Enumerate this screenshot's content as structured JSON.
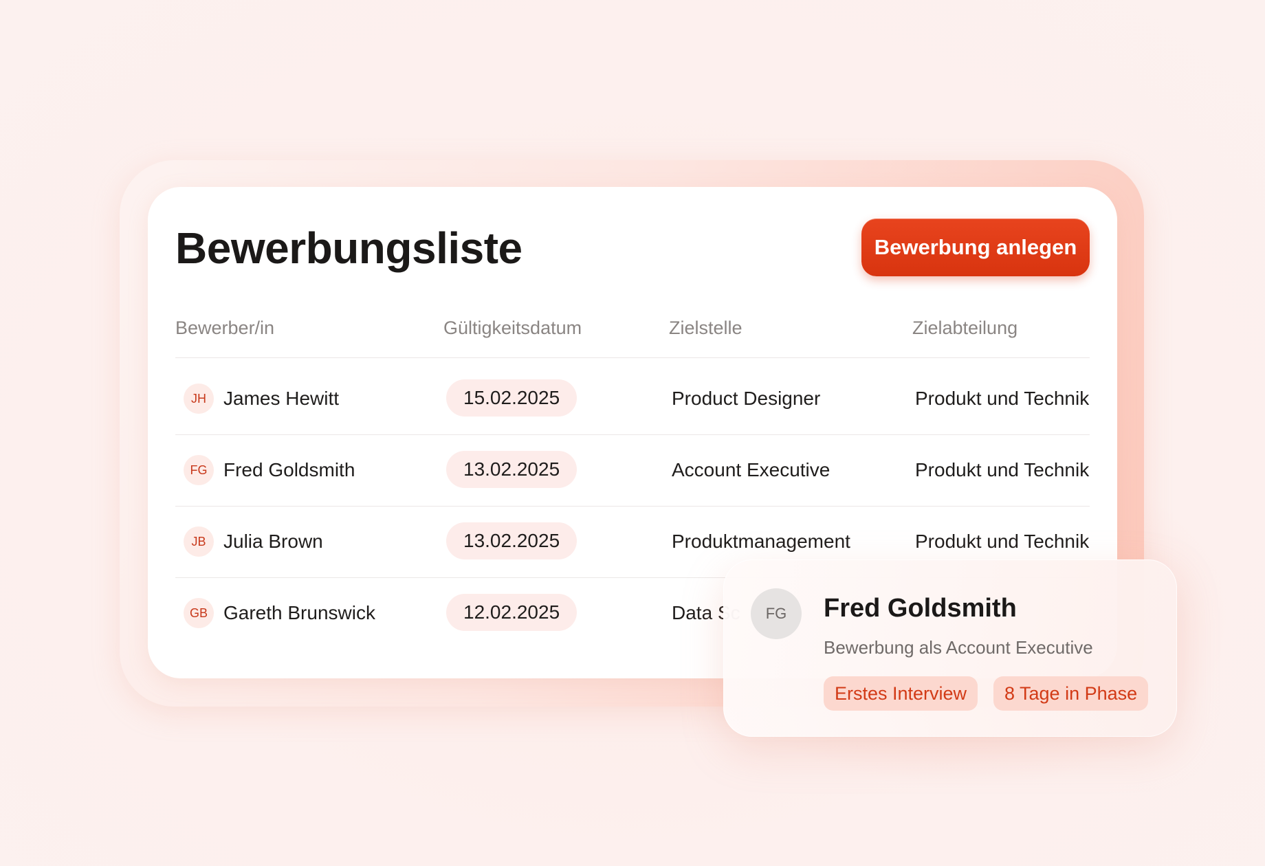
{
  "page": {
    "title": "Bewerbungsliste",
    "add_button_label": "Bewerbung anlegen"
  },
  "table": {
    "headers": [
      "Bewerber/in",
      "Gültigkeitsdatum",
      "Zielstelle",
      "Zielabteilung"
    ],
    "rows": [
      {
        "initials": "JH",
        "name": "James Hewitt",
        "date": "15.02.2025",
        "stelle": "Product Designer",
        "abteilung": "Produkt und Technik"
      },
      {
        "initials": "FG",
        "name": "Fred Goldsmith",
        "date": "13.02.2025",
        "stelle": "Account Executive",
        "abteilung": "Produkt und Technik"
      },
      {
        "initials": "JB",
        "name": "Julia Brown",
        "date": "13.02.2025",
        "stelle": "Produktmanagement",
        "abteilung": "Produkt und Technik"
      },
      {
        "initials": "GB",
        "name": "Gareth Brunswick",
        "date": "12.02.2025",
        "stelle": "Data Sc",
        "abteilung": ""
      }
    ]
  },
  "popup": {
    "initials": "FG",
    "name": "Fred Goldsmith",
    "subtitle": "Bewerbung als Account Executive",
    "tags": [
      "Erstes Interview",
      "8 Tage in Phase"
    ]
  },
  "colors": {
    "accent": "#dd3a14",
    "tag_bg": "#fcd8cf",
    "pill_bg": "#fdecea"
  }
}
